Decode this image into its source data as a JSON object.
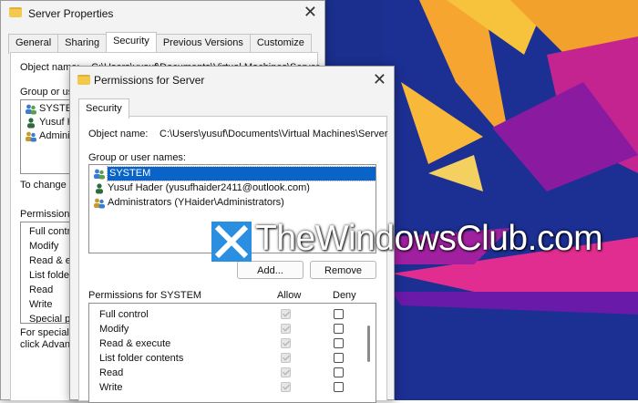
{
  "back_window": {
    "title": "Server Properties",
    "tabs": [
      "General",
      "Sharing",
      "Security",
      "Previous Versions",
      "Customize"
    ],
    "object_name_label": "Object name:",
    "object_name_value": "C:\\Users\\yusuf\\Documents\\Virtual Machines\\Server",
    "group_label": "Group or user names:",
    "users": [
      "SYSTEM",
      "Yusuf Hader",
      "Administrators"
    ],
    "change_text": "To change permissions, click Edit.",
    "permissions_label": "Permissions for SYSTEM",
    "permissions": [
      "Full control",
      "Modify",
      "Read & execute",
      "List folder contents",
      "Read",
      "Write",
      "Special permissions"
    ],
    "special_text_1": "For special permissions or advanced settings,",
    "special_text_2": "click Advanced."
  },
  "dialog": {
    "title": "Permissions for Server",
    "tab": "Security",
    "object_name_label": "Object name:",
    "object_name_value": "C:\\Users\\yusuf\\Documents\\Virtual Machines\\Server",
    "group_label": "Group or user names:",
    "users": [
      "SYSTEM",
      "Yusuf Hader (yusufhaider2411@outlook.com)",
      "Administrators (YHaider\\Administrators)"
    ],
    "add_button": "Add...",
    "remove_button": "Remove",
    "permissions_label": "Permissions for SYSTEM",
    "allow_header": "Allow",
    "deny_header": "Deny",
    "permissions": [
      "Full control",
      "Modify",
      "Read & execute",
      "List folder contents",
      "Read",
      "Write"
    ]
  },
  "watermark": {
    "text": "TheWindowsClub.com"
  },
  "colors": {
    "selection": "#0a64c8",
    "folder": "#f2c94c",
    "logo_blue": "#2a8fe0"
  }
}
